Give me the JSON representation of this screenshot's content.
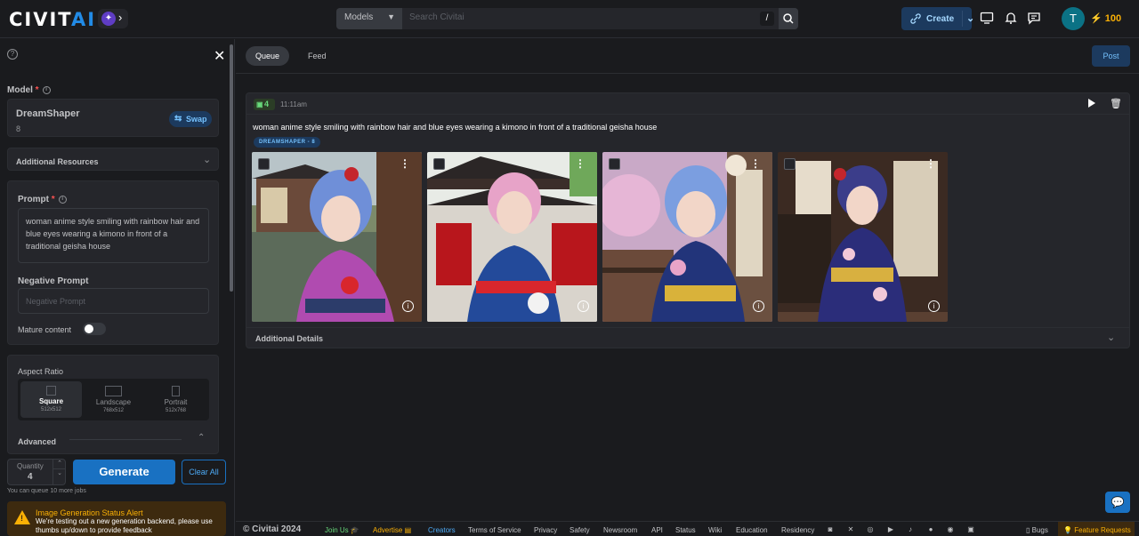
{
  "header": {
    "logo_text_main": "CIVIT",
    "logo_text_accent": "AI",
    "search_category": "Models",
    "search_placeholder": "Search Civitai",
    "search_shortcut": "/",
    "create_label": "Create",
    "avatar_initial": "T",
    "buzz_amount": "100"
  },
  "sidebar": {
    "model_label": "Model",
    "model_name": "DreamShaper",
    "model_version": "8",
    "swap_label": "Swap",
    "additional_resources_label": "Additional Resources",
    "prompt_label": "Prompt",
    "prompt_value": "woman anime style smiling with rainbow hair and blue eyes wearing a kimono in front of a traditional geisha house",
    "negative_prompt_label": "Negative Prompt",
    "negative_prompt_placeholder": "Negative Prompt",
    "mature_label": "Mature content",
    "aspect_ratio_label": "Aspect Ratio",
    "aspect_options": [
      {
        "label": "Square",
        "size": "512x512"
      },
      {
        "label": "Landscape",
        "size": "768x512"
      },
      {
        "label": "Portrait",
        "size": "512x768"
      }
    ],
    "advanced_label": "Advanced",
    "quantity_label": "Quantity",
    "quantity_value": "4",
    "generate_label": "Generate",
    "clear_all_label": "Clear All",
    "queue_note": "You can queue 10 more jobs",
    "alert_title": "Image Generation Status Alert",
    "alert_body": "We're testing out a new generation backend, please use thumbs up/down to provide feedback"
  },
  "main": {
    "tabs": [
      {
        "label": "Queue",
        "active": true
      },
      {
        "label": "Feed",
        "active": false
      }
    ],
    "post_label": "Post",
    "generation": {
      "image_count": "4",
      "time": "11:11am",
      "prompt": "woman anime style smiling with rainbow hair and blue eyes wearing a kimono in front of a traditional geisha house",
      "model_badge": "DREAMSHAPER - 8",
      "additional_details_label": "Additional Details"
    }
  },
  "footer": {
    "copyright": "© Civitai 2024",
    "links": [
      "Join Us",
      "Advertise",
      "Creators",
      "Terms of Service",
      "Privacy",
      "Safety",
      "Newsroom",
      "API",
      "Status",
      "Wiki",
      "Education",
      "Residency"
    ],
    "bugs_label": "Bugs",
    "feature_requests_label": "Feature Requests"
  },
  "colors": {
    "accent": "#1971c2",
    "background": "#1a1b1e",
    "card": "#25262b",
    "buzz": "#fab005"
  }
}
